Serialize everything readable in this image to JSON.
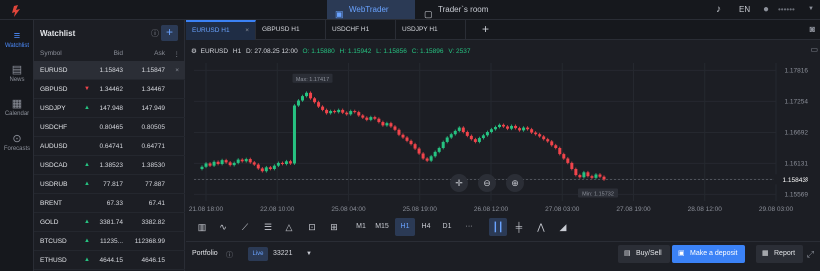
{
  "topbar": {
    "tab_webtrader": "WebTrader",
    "tab_traders_room": "Trader`s room",
    "lang": "EN",
    "user_masked": "••••••"
  },
  "sidebar": {
    "items": [
      {
        "label": "Watchlist",
        "icon": "list-icon"
      },
      {
        "label": "News",
        "icon": "news-icon"
      },
      {
        "label": "Calendar",
        "icon": "calendar-icon"
      },
      {
        "label": "Forecasts",
        "icon": "forecasts-icon"
      }
    ]
  },
  "watchlist": {
    "title": "Watchlist",
    "columns": [
      "Symbol",
      "Bid",
      "Ask"
    ],
    "rows": [
      {
        "symbol": "EURUSD",
        "bid": "1.15843",
        "ask": "1.15847",
        "dir": "",
        "selected": true
      },
      {
        "symbol": "GBPUSD",
        "bid": "1.34462",
        "ask": "1.34467",
        "dir": "down"
      },
      {
        "symbol": "USDJPY",
        "bid": "147.948",
        "ask": "147.949",
        "dir": "up"
      },
      {
        "symbol": "USDCHF",
        "bid": "0.80465",
        "ask": "0.80505",
        "dir": ""
      },
      {
        "symbol": "AUDUSD",
        "bid": "0.64741",
        "ask": "0.64771",
        "dir": ""
      },
      {
        "symbol": "USDCAD",
        "bid": "1.38523",
        "ask": "1.38530",
        "dir": "up"
      },
      {
        "symbol": "USDRUB",
        "bid": "77.817",
        "ask": "77.887",
        "dir": "up"
      },
      {
        "symbol": "BRENT",
        "bid": "67.33",
        "ask": "67.41",
        "dir": ""
      },
      {
        "symbol": "GOLD",
        "bid": "3381.74",
        "ask": "3382.82",
        "dir": "up"
      },
      {
        "symbol": "BTCUSD",
        "bid": "11235...",
        "ask": "112368.99",
        "dir": "up"
      },
      {
        "symbol": "ETHUSD",
        "bid": "4644.15",
        "ask": "4646.15",
        "dir": "up"
      }
    ]
  },
  "chart_tabs": [
    "EURUSD H1",
    "GBPUSD H1",
    "USDCHF H1",
    "USDJPY H1"
  ],
  "ohlc": {
    "symbol": "EURUSD",
    "tf": "H1",
    "date": "D: 27.08.25 12:00",
    "open": "O: 1.15880",
    "high": "H: 1.15942",
    "low": "L: 1.15856",
    "close": "C: 1.15896",
    "volume": "V: 2537"
  },
  "chart_data": {
    "type": "candlestick",
    "x_ticks": [
      "21.08 18:00",
      "22.08 10:00",
      "25.08 04:00",
      "25.08 19:00",
      "26.08 12:00",
      "27.08 03:00",
      "27.08 19:00",
      "28.08 12:00",
      "29.08 03:00"
    ],
    "y_ticks": [
      "1.17816",
      "1.17254",
      "1.16692",
      "1.16131",
      "1.15843",
      "1.15569"
    ],
    "current_price": "1.15843",
    "current_price_highlight": "43",
    "max_label": "Max: 1.17417",
    "min_label": "Min: 1.15732",
    "ylim": [
      1.1545,
      1.1795
    ],
    "candles_close": [
      1.1607,
      1.1613,
      1.1609,
      1.1616,
      1.1612,
      1.1619,
      1.1615,
      1.161,
      1.1614,
      1.162,
      1.1617,
      1.1621,
      1.1615,
      1.1611,
      1.1604,
      1.1599,
      1.1606,
      1.1603,
      1.1609,
      1.1614,
      1.1612,
      1.1617,
      1.1613,
      1.1718,
      1.1727,
      1.1735,
      1.1741,
      1.1731,
      1.1724,
      1.1716,
      1.171,
      1.1704,
      1.1708,
      1.1706,
      1.171,
      1.1705,
      1.1702,
      1.1708,
      1.1706,
      1.17,
      1.1696,
      1.1692,
      1.1697,
      1.1694,
      1.1688,
      1.1682,
      1.1686,
      1.168,
      1.1674,
      1.1665,
      1.166,
      1.1654,
      1.1648,
      1.164,
      1.1631,
      1.1622,
      1.1618,
      1.1626,
      1.1634,
      1.1641,
      1.1652,
      1.166,
      1.1666,
      1.1672,
      1.1678,
      1.167,
      1.1663,
      1.1657,
      1.1652,
      1.1659,
      1.1664,
      1.167,
      1.1675,
      1.1679,
      1.1683,
      1.168,
      1.1676,
      1.1681,
      1.1677,
      1.1673,
      1.1678,
      1.1675,
      1.1669,
      1.1666,
      1.1662,
      1.1657,
      1.1653,
      1.1646,
      1.1641,
      1.163,
      1.1622,
      1.1614,
      1.1603,
      1.1592,
      1.1588,
      1.1597,
      1.159,
      1.1587,
      1.1593,
      1.1589,
      1.1584
    ]
  },
  "toolbar": {
    "tools": [
      "candles-icon",
      "indicators-icon",
      "lines-icon",
      "fibonacci-icon",
      "shapes-icon",
      "magnet-icon",
      "screenshot-icon"
    ],
    "timeframes": [
      "M1",
      "M15",
      "H1",
      "H4",
      "D1"
    ],
    "active_tf": "H1",
    "more": "···"
  },
  "bottom": {
    "portfolio": "Portfolio",
    "live": "Live",
    "account": "33221",
    "buy_sell": "Buy/Sell",
    "deposit": "Make a deposit",
    "report": "Report"
  },
  "colors": {
    "accent": "#3b82f6",
    "up": "#26c281",
    "down": "#f0444b",
    "bg": "#1c1e24"
  }
}
